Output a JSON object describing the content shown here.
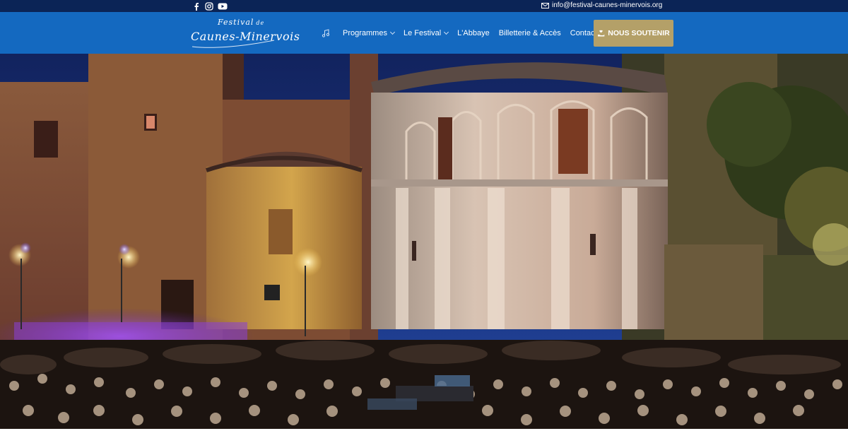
{
  "topbar": {
    "social_icons": [
      "facebook-icon",
      "instagram-icon",
      "youtube-icon"
    ],
    "email": "info@festival-caunes-minervois.org",
    "email_icon": "envelope-icon"
  },
  "header": {
    "logo": {
      "line1": "Festival",
      "line1_small": "de",
      "line2": "Caunes-Minervois"
    },
    "nav": {
      "icon": "music-note-icon",
      "items": [
        {
          "label": "Programmes",
          "dropdown": true
        },
        {
          "label": "Le Festival",
          "dropdown": true
        },
        {
          "label": "L'Abbaye",
          "dropdown": false
        },
        {
          "label": "Billetterie & Accès",
          "dropdown": false
        },
        {
          "label": "Contact",
          "dropdown": false
        }
      ]
    },
    "support_button": {
      "label": "NOUS SOUTENIR",
      "icon": "hand-heart-icon"
    }
  },
  "hero": {
    "image": "night-concert-abbey-photo"
  },
  "colors": {
    "topbar": "#0b2456",
    "header": "#1469c0",
    "button": "#b4a068",
    "text": "#ffffff"
  }
}
